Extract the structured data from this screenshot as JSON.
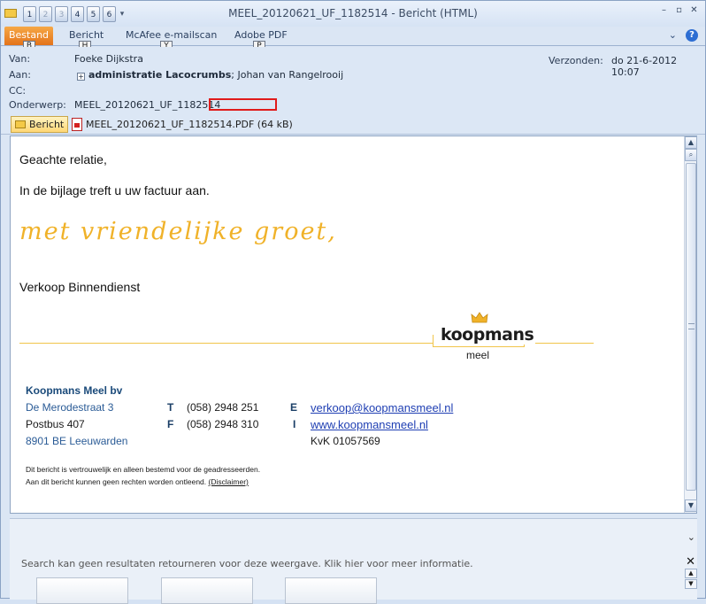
{
  "window": {
    "title": "MEEL_20120621_UF_1182514  -  Bericht (HTML)",
    "qat_numbers": [
      "1",
      "2",
      "3",
      "4",
      "5",
      "6"
    ],
    "controls": [
      "–",
      "▫",
      "✕"
    ]
  },
  "ribbon": {
    "file_tab": "Bestand",
    "tabs": [
      "Bericht",
      "McAfee e-mailscan",
      "Adobe PDF"
    ],
    "keytips": [
      "B",
      "H",
      "Y",
      "P"
    ],
    "right_icons": [
      "chevron-down",
      "help"
    ]
  },
  "header": {
    "from_label": "Van:",
    "from_value": "Foeke Dijkstra",
    "to_label": "Aan:",
    "to_group": "administratie Lacocrumbs",
    "to_rest": "; Johan van Rangelrooij",
    "cc_label": "CC:",
    "subject_label": "Onderwerp:",
    "subject_value": "MEEL_20120621_UF_1182514",
    "sent_label": "Verzonden:",
    "sent_value": "do 21-6-2012 10:07"
  },
  "attachments": {
    "message_tab": "Bericht",
    "file_name": "MEEL_20120621_UF_1182514.PDF (64 kB)"
  },
  "body": {
    "greeting": "Geachte relatie,",
    "intro": "In de bijlage treft u uw factuur aan.",
    "closing_script": "met vriendelijke groet,",
    "department": "Verkoop Binnendienst",
    "logo_word": "koopmans",
    "logo_sub": "meel",
    "company": "Koopmans Meel bv",
    "address1": "De Merodestraat 3",
    "address2": "Postbus 407",
    "address3": "8901 BE Leeuwarden",
    "tel_label": "T",
    "tel": "(058) 2948 251",
    "fax_label": "F",
    "fax": "(058) 2948 310",
    "email_label": "E",
    "email": "verkoop@koopmansmeel.nl",
    "web_label": "I",
    "web": "www.koopmansmeel.nl",
    "kvk": "KvK 01057569",
    "disclaimer_line1": "Dit bericht is vertrouwelijk en alleen bestemd voor de geadresseerden.",
    "disclaimer_line2": "Aan dit bericht kunnen geen rechten worden ontleend.",
    "disclaimer_link": "(Disclaimer)"
  },
  "people_pane": {
    "search_message": "Search kan geen resultaten retourneren voor deze weergave. Klik hier voor meer informatie."
  },
  "colors": {
    "accent_gold": "#f0b229",
    "file_tab_orange": "#e3731a",
    "link_blue": "#1f3fb3",
    "highlight_red": "#e01b1b"
  }
}
